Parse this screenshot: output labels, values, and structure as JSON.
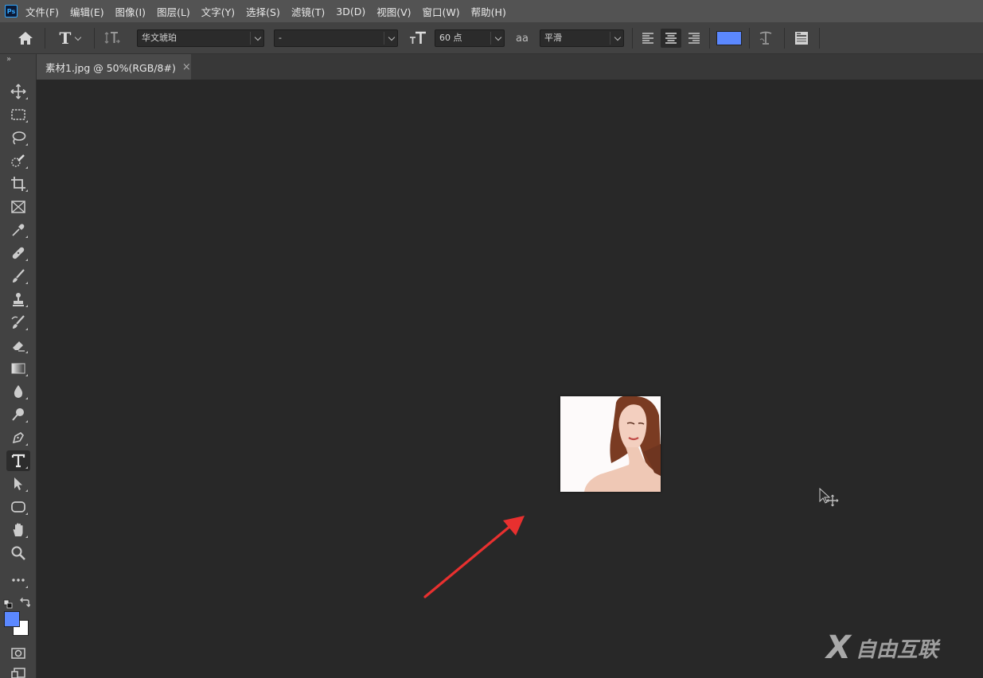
{
  "app": {
    "logo_text": "Ps"
  },
  "menu": [
    {
      "label": "文件(F)"
    },
    {
      "label": "编辑(E)"
    },
    {
      "label": "图像(I)"
    },
    {
      "label": "图层(L)"
    },
    {
      "label": "文字(Y)"
    },
    {
      "label": "选择(S)"
    },
    {
      "label": "滤镜(T)"
    },
    {
      "label": "3D(D)"
    },
    {
      "label": "视图(V)"
    },
    {
      "label": "窗口(W)"
    },
    {
      "label": "帮助(H)"
    }
  ],
  "options": {
    "tool_glyph": "T",
    "font_family": "华文琥珀",
    "font_style": "-",
    "font_size": "60 点",
    "aa_glyph": "aa",
    "antialias": "平滑",
    "text_color": "#5b88ff"
  },
  "document": {
    "tab_title": "素材1.jpg @ 50%(RGB/8#)",
    "close_glyph": "×"
  },
  "tools": {
    "active": "horizontal-type-tool",
    "foreground_color": "#5b88ff",
    "background_color": "#ffffff"
  },
  "annotation": {
    "arrow_color": "#e8302f"
  },
  "watermark": {
    "mark": "X",
    "text": "自由互联"
  }
}
